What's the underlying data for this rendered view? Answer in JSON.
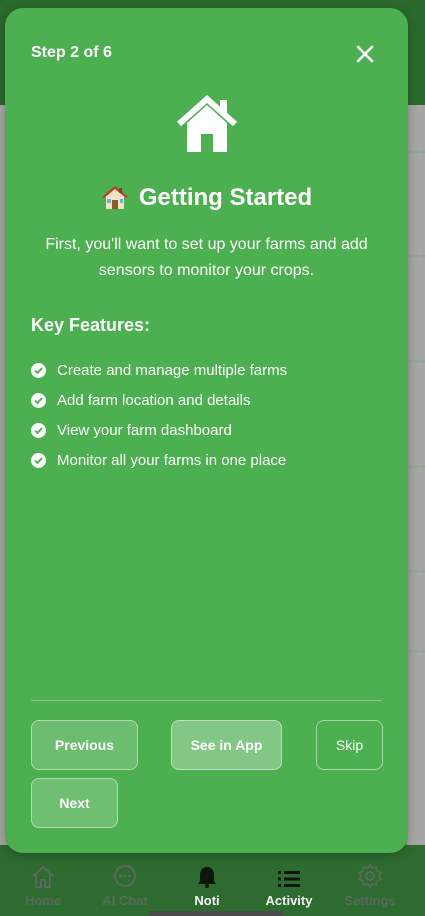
{
  "colors": {
    "modal_bg": "#4caf50",
    "text": "#ffffff",
    "app_header": "#2a6a2d",
    "nav_bar": "#2d6b30"
  },
  "modal": {
    "step_label": "Step 2 of 6",
    "close_icon": "close-icon",
    "hero_icon": "home-icon",
    "title_emoji_icon": "house-emoji-icon",
    "title": "Getting Started",
    "description": "First, you'll want to set up your farms and add sensors to monitor your crops.",
    "features_heading": "Key Features:",
    "features": [
      "Create and manage multiple farms",
      "Add farm location and details",
      "View your farm dashboard",
      "Monitor all your farms in one place"
    ],
    "buttons": {
      "previous": "Previous",
      "see_in_app": "See in App",
      "skip": "Skip",
      "next": "Next"
    }
  },
  "bottom_nav": {
    "items": [
      {
        "label": "Home",
        "icon": "home-icon"
      },
      {
        "label": "AI Chat",
        "icon": "chat-icon"
      },
      {
        "label": "Noti",
        "icon": "bell-icon"
      },
      {
        "label": "Activity",
        "icon": "list-icon"
      },
      {
        "label": "Settings",
        "icon": "gear-icon"
      }
    ]
  }
}
